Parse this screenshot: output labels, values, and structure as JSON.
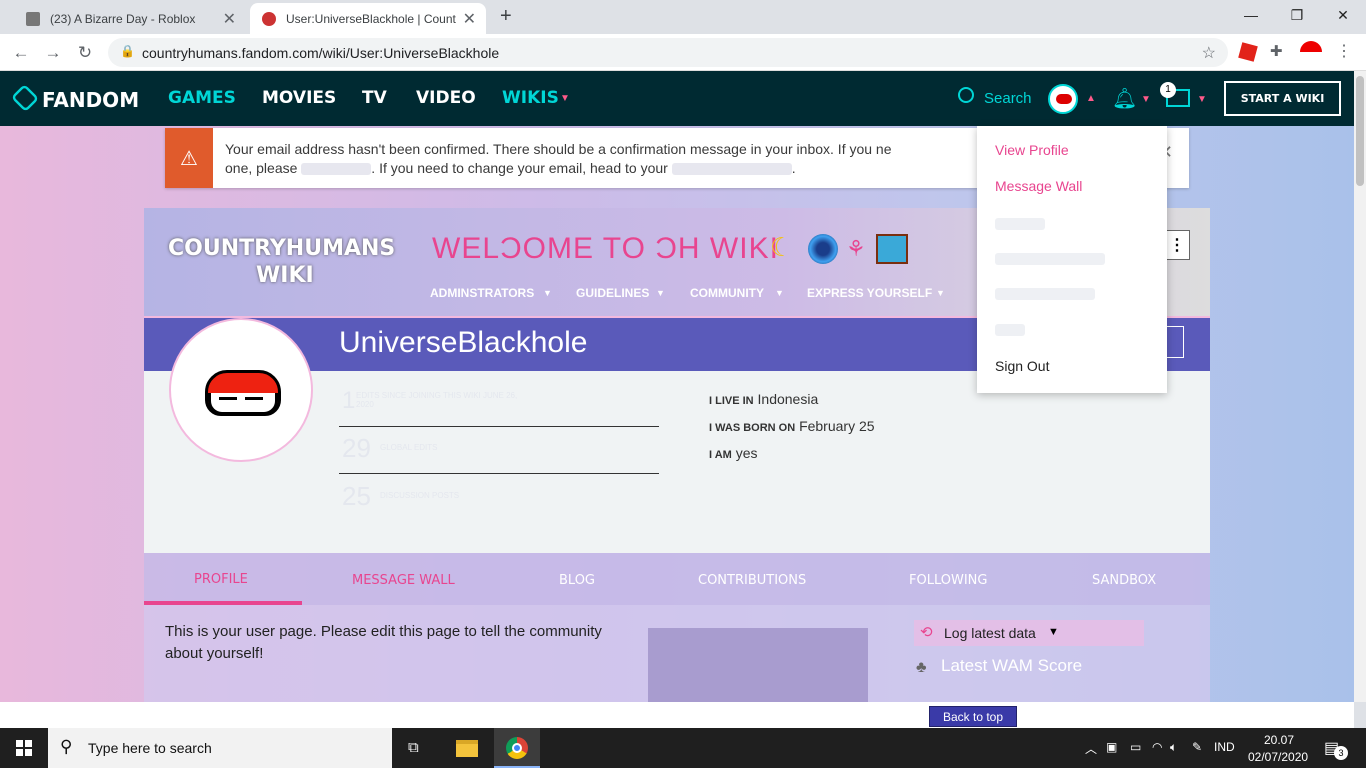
{
  "browser": {
    "tabs": [
      {
        "title": "(23) A Bizarre Day - Roblox",
        "active": false
      },
      {
        "title": "User:UniverseBlackhole | Country",
        "active": true
      }
    ],
    "new_tab": "+",
    "url": "countryhumans.fandom.com/wiki/User:UniverseBlackhole",
    "window_controls": [
      "—",
      "❐",
      "✕"
    ]
  },
  "fandom_nav": {
    "logo": "FANDOM",
    "links": [
      "GAMES",
      "MOVIES",
      "TV",
      "VIDEO",
      "WIKIS"
    ],
    "search_label": "Search",
    "notification_count": "1",
    "start_wiki": "START A WIKI"
  },
  "banner": {
    "message_part1": "Your email address hasn't been confirmed. There should be a confirmation message in your inbox. If you ne",
    "message_part2": "one, please",
    "message_part3": ". If you need to change your email, head to your",
    "message_part4": ".",
    "close": "✕"
  },
  "wiki_header": {
    "wiki_name_line1": "COUNTRYHUMANS",
    "wiki_name_line2": "WIKI",
    "welcome": "WELƆOME TO ƆH WIKI",
    "nav": [
      "ADMINSTRATORS",
      "GUIDELINES",
      "COMMUNITY",
      "EXPRESS YOURSELF"
    ]
  },
  "profile": {
    "username": "UniverseBlackhole",
    "stats": [
      {
        "value": "1",
        "label": "EDITS SINCE JOINING THIS WIKI JUNE 26, 2020"
      },
      {
        "value": "29",
        "label": "GLOBAL EDITS"
      },
      {
        "value": "25",
        "label": "DISCUSSION POSTS"
      }
    ],
    "facts": [
      {
        "label": "I LIVE IN",
        "value": "Indonesia"
      },
      {
        "label": "I WAS BORN ON",
        "value": "February 25"
      },
      {
        "label": "I AM",
        "value": "yes"
      }
    ]
  },
  "profile_tabs": [
    "PROFILE",
    "MESSAGE WALL",
    "BLOG",
    "CONTRIBUTIONS",
    "FOLLOWING",
    "SANDBOX"
  ],
  "content": {
    "intro": "This is your user page. Please edit this page to tell the community about yourself!",
    "log_latest": "Log latest data",
    "latest_wam": "Latest WAM Score"
  },
  "dropdown": {
    "view_profile": "View Profile",
    "message_wall": "Message Wall",
    "sign_out": "Sign Out"
  },
  "bottom": {
    "back_to_top": "Back to top"
  },
  "taskbar": {
    "search_placeholder": "Type here to search",
    "language": "IND",
    "time": "20.07",
    "date": "02/07/2020",
    "notif_badge": "3"
  }
}
